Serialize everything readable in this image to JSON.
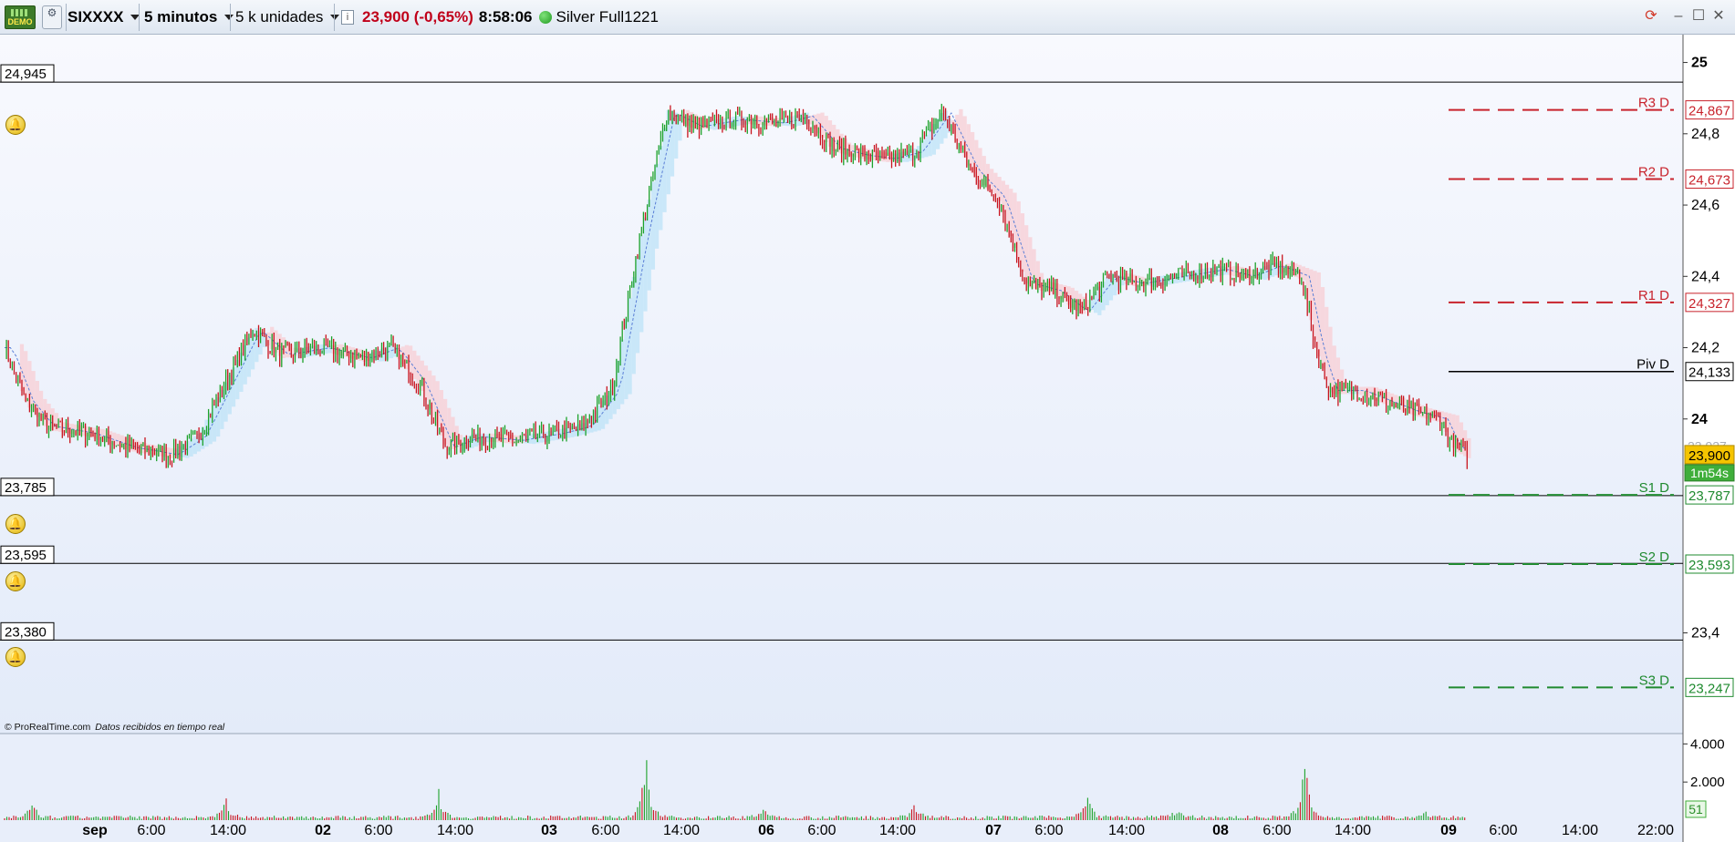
{
  "toolbar": {
    "demo_label": "DEMO",
    "instrument": "SIXXXX",
    "timeframe": "5 minutos",
    "units": "5 k unidades",
    "price_change": "23,900 (-0,65%)",
    "time": "8:58:06",
    "account": "Silver Full1221",
    "colors": {
      "price_change": "#c0001a",
      "connection": "#2aa52a"
    }
  },
  "chart_data": {
    "type": "line",
    "ylim": [
      23.23,
      25.05
    ],
    "yticks": [
      {
        "value": 25,
        "label": "25"
      },
      {
        "value": 24.8,
        "label": "24,8"
      },
      {
        "value": 24.6,
        "label": "24,6"
      },
      {
        "value": 24.4,
        "label": "24,4"
      },
      {
        "value": 24.2,
        "label": "24,2"
      },
      {
        "value": 24,
        "label": "24"
      },
      {
        "value": 23.4,
        "label": "23,4"
      }
    ],
    "xticks": [
      {
        "label": "sep",
        "bold": true
      },
      {
        "label": "6:00",
        "bold": false
      },
      {
        "label": "14:00",
        "bold": false
      },
      {
        "label": "02",
        "bold": true
      },
      {
        "label": "6:00",
        "bold": false
      },
      {
        "label": "14:00",
        "bold": false
      },
      {
        "label": "03",
        "bold": true
      },
      {
        "label": "6:00",
        "bold": false
      },
      {
        "label": "14:00",
        "bold": false
      },
      {
        "label": "06",
        "bold": true
      },
      {
        "label": "6:00",
        "bold": false
      },
      {
        "label": "14:00",
        "bold": false
      },
      {
        "label": "07",
        "bold": true
      },
      {
        "label": "6:00",
        "bold": false
      },
      {
        "label": "14:00",
        "bold": false
      },
      {
        "label": "08",
        "bold": true
      },
      {
        "label": "6:00",
        "bold": false
      },
      {
        "label": "14:00",
        "bold": false
      },
      {
        "label": "09",
        "bold": true
      },
      {
        "label": "6:00",
        "bold": false
      },
      {
        "label": "14:00",
        "bold": false
      },
      {
        "label": "22:00",
        "bold": false
      }
    ],
    "price_path": [
      [
        0,
        24.2
      ],
      [
        1.5,
        24.05
      ],
      [
        3,
        23.98
      ],
      [
        6,
        23.96
      ],
      [
        9,
        23.92
      ],
      [
        12,
        23.9
      ],
      [
        14,
        23.95
      ],
      [
        16,
        24.1
      ],
      [
        18,
        24.25
      ],
      [
        20,
        24.18
      ],
      [
        23,
        24.2
      ],
      [
        26,
        24.17
      ],
      [
        28,
        24.2
      ],
      [
        30,
        24.1
      ],
      [
        32,
        23.92
      ],
      [
        34,
        23.95
      ],
      [
        37,
        23.94
      ],
      [
        40,
        23.96
      ],
      [
        42,
        23.98
      ],
      [
        44,
        24.08
      ],
      [
        46,
        24.5
      ],
      [
        48,
        24.86
      ],
      [
        50,
        24.82
      ],
      [
        53,
        24.84
      ],
      [
        56,
        24.83
      ],
      [
        58,
        24.85
      ],
      [
        60,
        24.76
      ],
      [
        62,
        24.74
      ],
      [
        64,
        24.73
      ],
      [
        66,
        24.75
      ],
      [
        68,
        24.86
      ],
      [
        70,
        24.7
      ],
      [
        72,
        24.62
      ],
      [
        74,
        24.38
      ],
      [
        76,
        24.36
      ],
      [
        78,
        24.3
      ],
      [
        80,
        24.4
      ],
      [
        82,
        24.38
      ],
      [
        85,
        24.4
      ],
      [
        88,
        24.42
      ],
      [
        90,
        24.4
      ],
      [
        92,
        24.43
      ],
      [
        94,
        24.4
      ],
      [
        95,
        24.2
      ],
      [
        96,
        24.08
      ],
      [
        98,
        24.08
      ],
      [
        100,
        24.05
      ],
      [
        102,
        24.02
      ],
      [
        104,
        24.0
      ],
      [
        105,
        23.92
      ],
      [
        106,
        23.9
      ]
    ],
    "volume_peaks": [
      {
        "x": 2,
        "v": 900
      },
      {
        "x": 16,
        "v": 1200
      },
      {
        "x": 31.5,
        "v": 1600
      },
      {
        "x": 46.5,
        "v": 4200
      },
      {
        "x": 55,
        "v": 600
      },
      {
        "x": 66,
        "v": 900
      },
      {
        "x": 78.5,
        "v": 1500
      },
      {
        "x": 85,
        "v": 500
      },
      {
        "x": 94.2,
        "v": 3800
      },
      {
        "x": 103,
        "v": 400
      }
    ],
    "volume_ylim": [
      0,
      4400
    ],
    "volume_ticks": [
      {
        "value": 4000,
        "label": "4.000"
      },
      {
        "value": 2000,
        "label": "2.000"
      }
    ],
    "volume_last": "51",
    "alert_levels": [
      {
        "value": 24.945,
        "label": "24,945"
      },
      {
        "value": 23.785,
        "label": "23,785"
      },
      {
        "value": 23.595,
        "label": "23,595"
      },
      {
        "value": 23.38,
        "label": "23,380"
      }
    ],
    "pivots": [
      {
        "name": "R3 D",
        "value": 24.867,
        "label": "24,867",
        "color": "#c8232c",
        "style": "dashed"
      },
      {
        "name": "R2 D",
        "value": 24.673,
        "label": "24,673",
        "color": "#c8232c",
        "style": "dashed"
      },
      {
        "name": "R1 D",
        "value": 24.327,
        "label": "24,327",
        "color": "#c8232c",
        "style": "dashed"
      },
      {
        "name": "Piv D",
        "value": 24.133,
        "label": "24,133",
        "color": "#000000",
        "style": "solid"
      },
      {
        "name": "S1 D",
        "value": 23.787,
        "label": "23,787",
        "color": "#1f8a2f",
        "style": "dashed"
      },
      {
        "name": "S2 D",
        "value": 23.593,
        "label": "23,593",
        "color": "#1f8a2f",
        "style": "dashed"
      },
      {
        "name": "S3 D",
        "value": 23.247,
        "label": "23,247",
        "color": "#1f8a2f",
        "style": "dashed"
      }
    ],
    "last_price": {
      "value": 23.9,
      "label": "23,900",
      "color": "#f5c400"
    },
    "bar_timer": "1m54s",
    "faded_labels": [
      "23,927",
      "23,910"
    ],
    "credit": "© ProRealTime.com",
    "credit_note": "Datos recibidos en tiempo real",
    "grid": false
  }
}
